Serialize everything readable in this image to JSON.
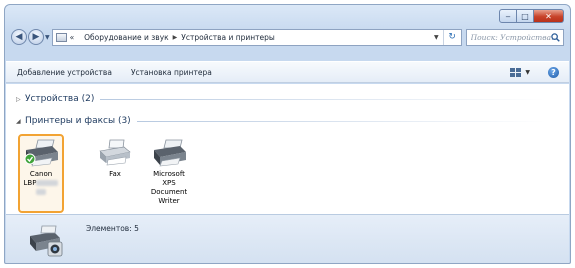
{
  "window": {
    "caption_minimize": "‒",
    "caption_maximize": "□",
    "caption_close": "✕"
  },
  "address_bar": {
    "prefix": "«",
    "crumbs": [
      "Оборудование и звук",
      "Устройства и принтеры"
    ]
  },
  "search": {
    "placeholder": "Поиск: Устройства..."
  },
  "toolbar": {
    "add_device": "Добавление устройства",
    "add_printer": "Установка принтера"
  },
  "groups": [
    {
      "label": "Устройства (2)",
      "expanded": false
    },
    {
      "label": "Принтеры и факсы (3)",
      "expanded": true
    }
  ],
  "devices": [
    {
      "label_line1": "Canon",
      "label_line2": "LBP",
      "selected": true,
      "default": true
    },
    {
      "label_line1": "Fax",
      "selected": false
    },
    {
      "label_line1": "Microsoft",
      "label_line2": "XPS",
      "label_line3": "Document",
      "label_line4": "Writer",
      "selected": false
    }
  ],
  "status": {
    "items_text": "Элементов: 5"
  },
  "icons": {
    "back": "back-arrow-icon",
    "forward": "forward-arrow-icon",
    "refresh": "refresh-icon",
    "search": "search-icon",
    "views": "views-icon",
    "help": "help-icon",
    "printer": "printer-icon",
    "default_check": "check-icon"
  },
  "colors": {
    "selection_border": "#f2a333",
    "close_button": "#c8432a",
    "chrome": "#c7d9ef"
  }
}
